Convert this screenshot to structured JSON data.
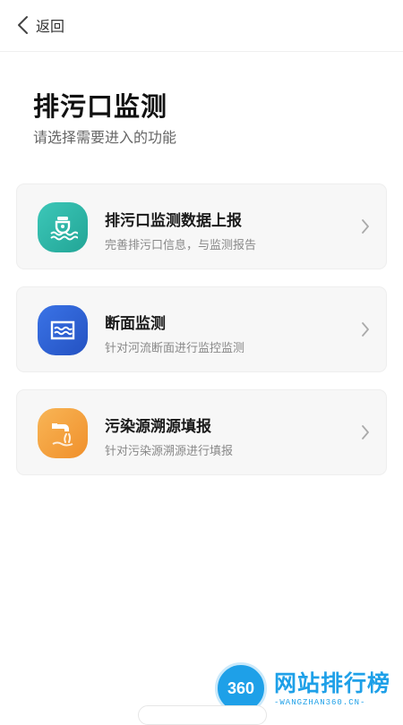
{
  "nav": {
    "back_label": "返回"
  },
  "header": {
    "title": "排污口监测",
    "subtitle": "请选择需要进入的功能"
  },
  "cards": [
    {
      "title": "排污口监测数据上报",
      "desc": "完善排污口信息，与监测报告",
      "icon": "outfall-water-icon",
      "color": "#2bb3a6"
    },
    {
      "title": "断面监测",
      "desc": "针对河流断面进行监控监测",
      "icon": "river-section-icon",
      "color": "#2f63d6"
    },
    {
      "title": "污染源溯源填报",
      "desc": "针对污染源溯源进行填报",
      "icon": "pipe-discharge-icon",
      "color": "#f5a03c"
    }
  ],
  "watermark": {
    "badge": "360",
    "title": "网站排行榜",
    "url": "-WANGZHAN360.CN-"
  }
}
